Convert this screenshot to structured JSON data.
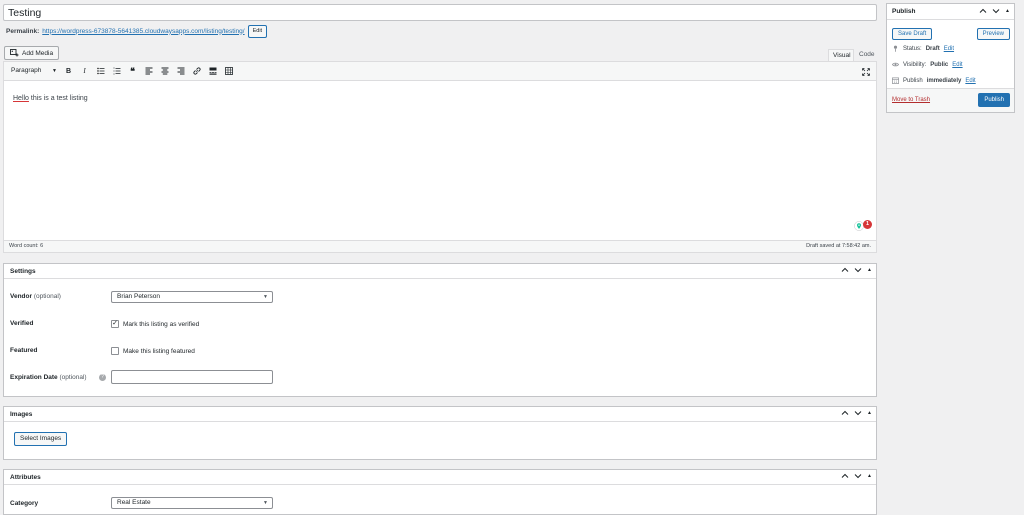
{
  "post": {
    "title": "Testing",
    "permalink_label": "Permalink:",
    "permalink_url": "https://wordpress-673878-5641385.cloudwaysapps.com/listing/testing/",
    "permalink_edit": "Edit"
  },
  "editor": {
    "add_media": "Add Media",
    "tab_visual": "Visual",
    "tab_code": "Code",
    "format": "Paragraph",
    "content_first_word": "Hello",
    "content_rest": " this is a test listing",
    "word_count": "Word count: 6",
    "draft_saved": "Draft saved at 7:58:42 am.",
    "grammarly_count": "1"
  },
  "settings": {
    "title": "Settings",
    "vendor_label": "Vendor",
    "vendor_optional": "(optional)",
    "vendor_value": "Brian Peterson",
    "verified_label": "Verified",
    "verified_text": "Mark this listing as verified",
    "verified_checked": true,
    "featured_label": "Featured",
    "featured_text": "Make this listing featured",
    "featured_checked": false,
    "expiration_label": "Expiration Date",
    "expiration_optional": "(optional)",
    "expiration_value": ""
  },
  "images": {
    "title": "Images",
    "select_button": "Select Images"
  },
  "attributes": {
    "title": "Attributes",
    "category_label": "Category",
    "category_value": "Real Estate"
  },
  "publish": {
    "title": "Publish",
    "save_draft": "Save Draft",
    "preview": "Preview",
    "status_label": "Status:",
    "status_value": "Draft",
    "visibility_label": "Visibility:",
    "visibility_value": "Public",
    "publish_label": "Publish",
    "publish_value": "immediately",
    "edit": "Edit",
    "move_to_trash": "Move to Trash",
    "publish_button": "Publish"
  },
  "colors": {
    "accent": "#2271b1",
    "danger": "#b32d2e",
    "background": "#f0f0f1"
  }
}
